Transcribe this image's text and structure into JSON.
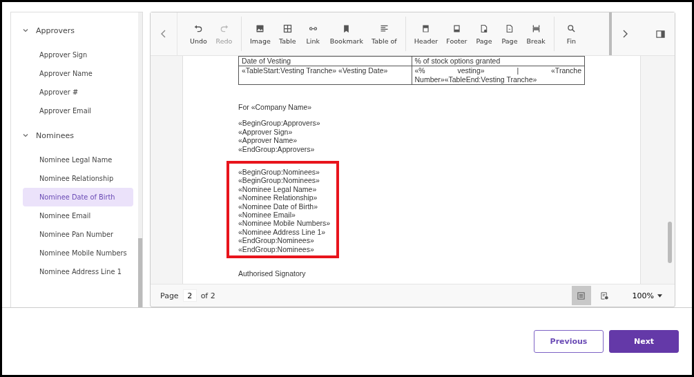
{
  "sidebar": {
    "groups": [
      {
        "label": "Approvers",
        "expanded": true,
        "children": [
          {
            "label": "Approver Sign",
            "selected": false
          },
          {
            "label": "Approver Name",
            "selected": false
          },
          {
            "label": "Approver #",
            "selected": false
          },
          {
            "label": "Approver Email",
            "selected": false
          }
        ]
      },
      {
        "label": "Nominees",
        "expanded": true,
        "children": [
          {
            "label": "Nominee Legal Name",
            "selected": false
          },
          {
            "label": "Nominee Relationship",
            "selected": false
          },
          {
            "label": "Nominee Date of Birth",
            "selected": true
          },
          {
            "label": "Nominee Email",
            "selected": false
          },
          {
            "label": "Nominee Pan Number",
            "selected": false
          },
          {
            "label": "Nominee Mobile Numbers",
            "selected": false
          },
          {
            "label": "Nominee Address Line 1",
            "selected": false
          }
        ]
      }
    ]
  },
  "toolbar": {
    "groups": [
      [
        {
          "label": "Undo",
          "disabled": false
        },
        {
          "label": "Redo",
          "disabled": true
        }
      ],
      [
        {
          "label": "Image",
          "disabled": false
        },
        {
          "label": "Table",
          "disabled": false
        },
        {
          "label": "Link",
          "disabled": false
        },
        {
          "label": "Bookmark",
          "disabled": false
        },
        {
          "label": "Table of",
          "disabled": false
        }
      ],
      [
        {
          "label": "Header",
          "disabled": false
        },
        {
          "label": "Footer",
          "disabled": false
        },
        {
          "label": "Page",
          "disabled": false
        },
        {
          "label": "Page",
          "disabled": false
        },
        {
          "label": "Break",
          "disabled": false
        }
      ],
      [
        {
          "label": "Fin",
          "disabled": false
        }
      ]
    ]
  },
  "document": {
    "table": {
      "rows": [
        [
          "Date of Vesting",
          "% of stock options granted"
        ],
        [
          "«TableStart:Vesting Tranche» «Vesting Date»",
          "«% vesting» | «Tranche Number»«TableEnd:Vesting Tranche»"
        ]
      ]
    },
    "blocks": [
      {
        "lines": [
          "For «Company Name»"
        ],
        "highlighted": false
      },
      {
        "lines": [
          "«BeginGroup:Approvers»",
          "«Approver Sign»",
          "«Approver Name»",
          "«EndGroup:Approvers»"
        ],
        "highlighted": false
      },
      {
        "lines": [
          "«BeginGroup:Nominees»",
          "«BeginGroup:Nominees»",
          "«Nominee Legal Name»",
          "«Nominee Relationship»",
          "«Nominee Date of Birth»",
          "«Nominee Email»",
          "«Nominee Mobile Numbers»",
          "«Nominee Address Line 1»",
          "«EndGroup:Nominees»",
          "«EndGroup:Nominees»"
        ],
        "highlighted": true
      },
      {
        "lines": [
          "Authorised Signatory"
        ],
        "highlighted": false
      }
    ]
  },
  "status_bar": {
    "page_label": "Page",
    "page": "2",
    "of_label": "of 2",
    "zoom": "100%"
  },
  "buttons": {
    "previous": "Previous",
    "next": "Next"
  }
}
